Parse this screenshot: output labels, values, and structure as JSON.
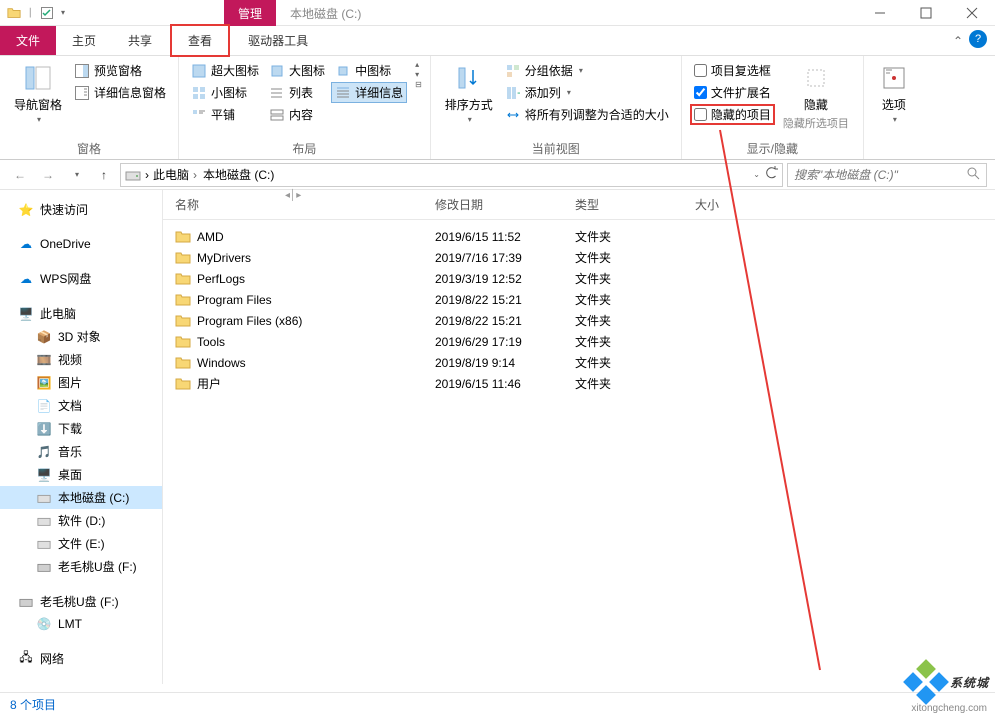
{
  "titlebar": {
    "context_tab": "管理",
    "inactive_tab": "本地磁盘 (C:)"
  },
  "menubar": {
    "file": "文件",
    "home": "主页",
    "share": "共享",
    "view": "查看",
    "drive_tools": "驱动器工具"
  },
  "ribbon": {
    "panes": {
      "nav_pane": "导航窗格",
      "preview_pane": "预览窗格",
      "details_pane": "详细信息窗格",
      "label": "窗格"
    },
    "layout": {
      "xl_icons": "超大图标",
      "l_icons": "大图标",
      "m_icons": "中图标",
      "s_icons": "小图标",
      "list": "列表",
      "details": "详细信息",
      "tiles": "平铺",
      "content": "内容",
      "label": "布局"
    },
    "current_view": {
      "sort_by": "排序方式",
      "group_by": "分组依据",
      "add_columns": "添加列",
      "size_all": "将所有列调整为合适的大小",
      "label": "当前视图"
    },
    "show_hide": {
      "item_checkboxes": "项目复选框",
      "file_ext": "文件扩展名",
      "hidden_items": "隐藏的项目",
      "hide_selected": "隐藏所选项目",
      "hide_btn": "隐藏",
      "label": "显示/隐藏"
    },
    "options": {
      "options": "选项",
      "label": ""
    }
  },
  "breadcrumb": {
    "pc": "此电脑",
    "drive": "本地磁盘 (C:)"
  },
  "search": {
    "placeholder": "搜索\"本地磁盘 (C:)\""
  },
  "navpane": {
    "quick_access": "快速访问",
    "onedrive": "OneDrive",
    "wps": "WPS网盘",
    "this_pc": "此电脑",
    "objects3d": "3D 对象",
    "videos": "视频",
    "pictures": "图片",
    "documents": "文档",
    "downloads": "下载",
    "music": "音乐",
    "desktop": "桌面",
    "drive_c": "本地磁盘 (C:)",
    "drive_d": "软件 (D:)",
    "drive_e": "文件 (E:)",
    "drive_f": "老毛桃U盘 (F:)",
    "drive_f2": "老毛桃U盘 (F:)",
    "lmt": "LMT",
    "network": "网络"
  },
  "columns": {
    "name": "名称",
    "date": "修改日期",
    "type": "类型",
    "size": "大小"
  },
  "rows": [
    {
      "name": "AMD",
      "date": "2019/6/15 11:52",
      "type": "文件夹"
    },
    {
      "name": "MyDrivers",
      "date": "2019/7/16 17:39",
      "type": "文件夹"
    },
    {
      "name": "PerfLogs",
      "date": "2019/3/19 12:52",
      "type": "文件夹"
    },
    {
      "name": "Program Files",
      "date": "2019/8/22 15:21",
      "type": "文件夹"
    },
    {
      "name": "Program Files (x86)",
      "date": "2019/8/22 15:21",
      "type": "文件夹"
    },
    {
      "name": "Tools",
      "date": "2019/6/29 17:19",
      "type": "文件夹"
    },
    {
      "name": "Windows",
      "date": "2019/8/19 9:14",
      "type": "文件夹"
    },
    {
      "name": "用户",
      "date": "2019/6/15 11:46",
      "type": "文件夹"
    }
  ],
  "status": {
    "count": "8 个项目"
  },
  "watermark": {
    "text": "系统城",
    "url": "xitongcheng.com"
  }
}
